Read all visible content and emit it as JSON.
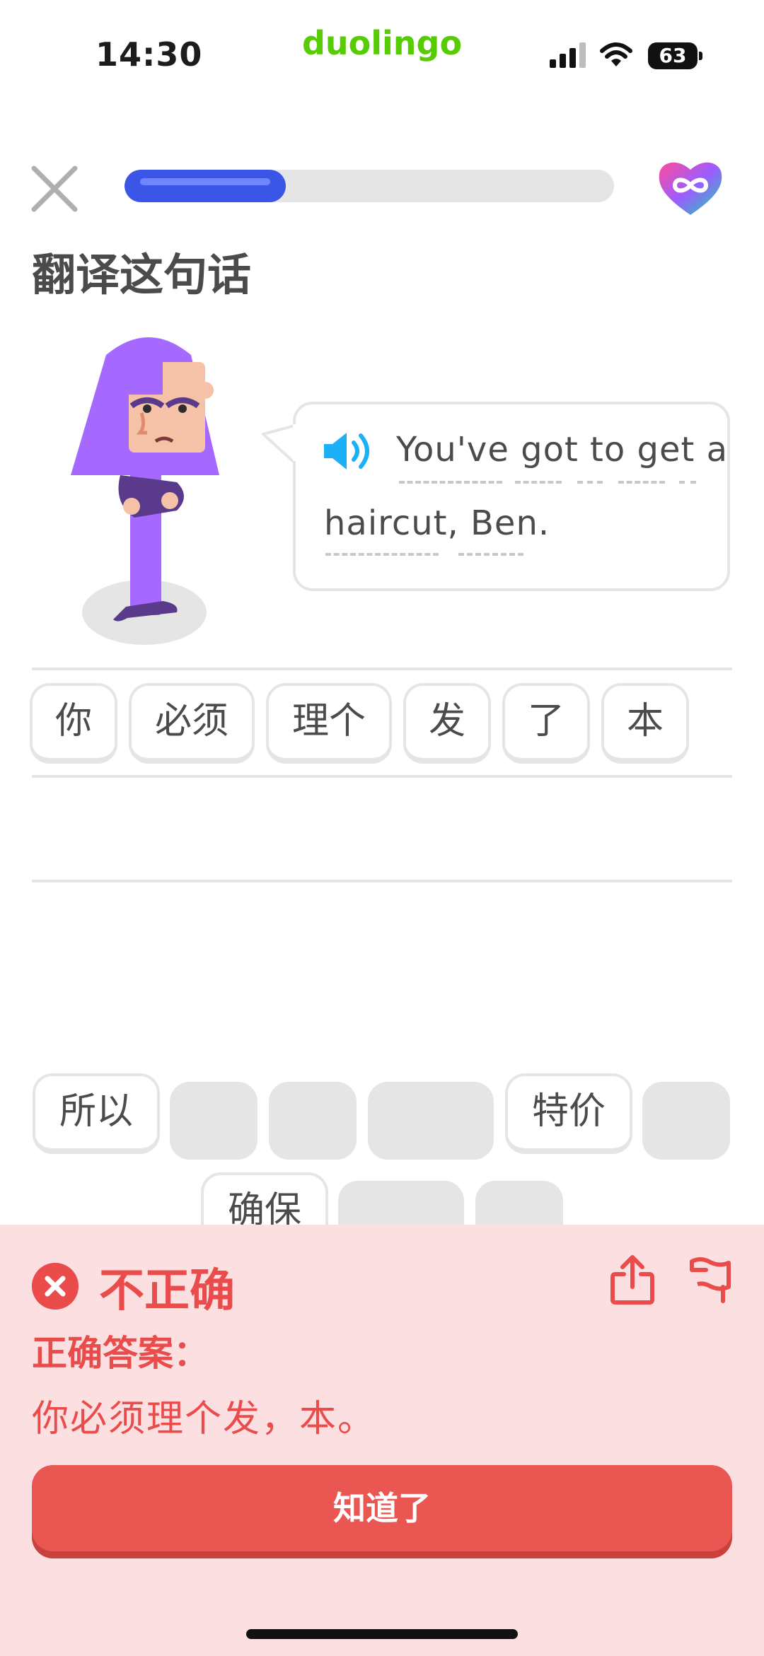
{
  "status_bar": {
    "time": "14:30",
    "brand": "duolingo",
    "battery": "63"
  },
  "exercise": {
    "progress_fraction": 0.33,
    "prompt_title": "翻译这句话",
    "sentence_line1": "You've got to get a",
    "sentence_line2": "haircut, Ben."
  },
  "answer_tiles": [
    "你",
    "必须",
    "理个",
    "发",
    "了",
    "本"
  ],
  "word_bank": {
    "row1_first": "所以",
    "row1_special": "特价",
    "row2_first": "确保"
  },
  "feedback": {
    "title": "不正确",
    "correct_answer_label": "正确答案：",
    "correct_answer": "你必须理个发，本。",
    "continue_button": "知道了"
  },
  "colors": {
    "accent_blue": "#3b55e6",
    "brand_green": "#58cc02",
    "error_red": "#ea4b4b",
    "sheet_bg": "#fcdfe0"
  },
  "icons": [
    "close-icon",
    "infinite-heart-icon",
    "speaker-icon",
    "error-x-icon",
    "share-icon",
    "flag-icon"
  ]
}
